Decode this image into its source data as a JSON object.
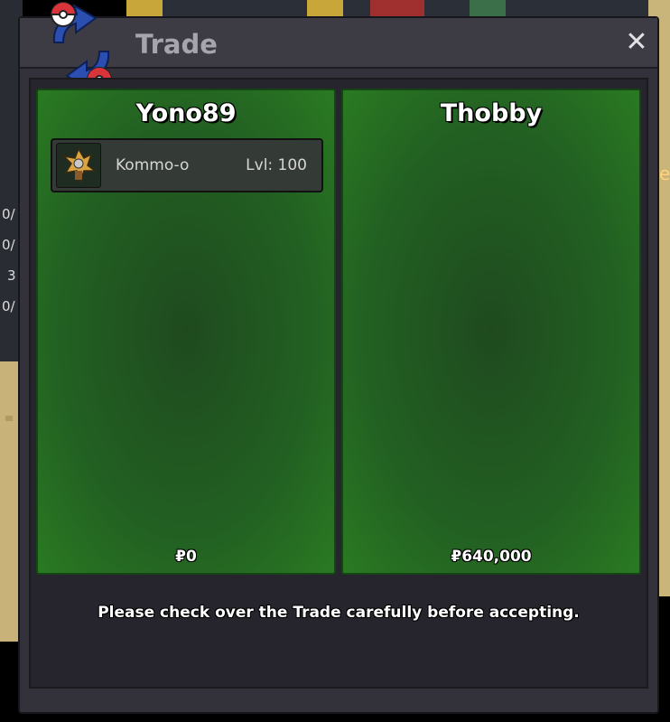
{
  "window": {
    "title": "Trade",
    "close_symbol": "✕",
    "icon": "trade-swap-icon"
  },
  "left_panel": {
    "player": "Yono89",
    "money": "₽0",
    "items": [
      {
        "name": "Kommo-o",
        "level": "Lvl: 100",
        "icon": "kommo-o-sprite-icon"
      }
    ]
  },
  "right_panel": {
    "player": "Thobby",
    "money": "₽640,000",
    "items": []
  },
  "notice": "Please check over the Trade carefully before accepting.",
  "background": {
    "left_labels": [
      "0/",
      "0/",
      "3",
      "0/"
    ],
    "right_label": "e"
  },
  "colors": {
    "panel_green": "#226022",
    "window_bg": "#33323b",
    "title_text": "#a6a5ad"
  }
}
